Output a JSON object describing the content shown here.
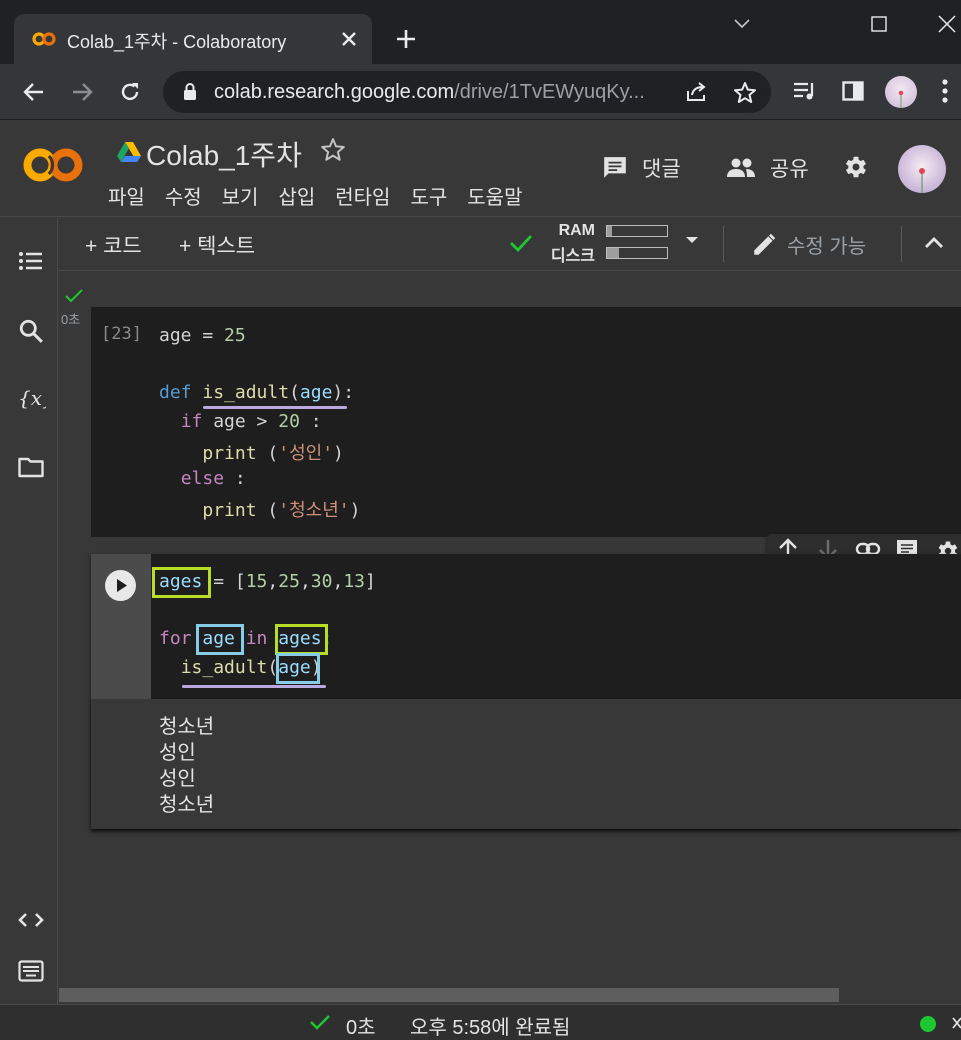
{
  "browser": {
    "tab_title": "Colab_1주차 - Colaboratory",
    "url_host": "colab.research.google.com",
    "url_path": "/drive/1TvEWyuqKy..."
  },
  "colab": {
    "notebook_title": "Colab_1주차",
    "menu": [
      "파일",
      "수정",
      "보기",
      "삽입",
      "런타임",
      "도구",
      "도움말"
    ],
    "comment_label": "댓글",
    "share_label": "공유"
  },
  "toolbar": {
    "add_code": "+ 코드",
    "add_text": "+ 텍스트",
    "ram_label": "RAM",
    "disk_label": "디스크",
    "ram_usage": 0.08,
    "disk_usage": 0.2,
    "edit_mode": "수정 가능"
  },
  "cells": {
    "cell1": {
      "execution_count": "[23]",
      "lines": [
        "age = 25",
        "",
        "def is_adult(age):",
        "  if age > 20 :",
        "    print ('성인')",
        "  else :",
        "    print ('청소년')"
      ]
    },
    "cell2": {
      "status_time": "0초",
      "lines": [
        "ages = [15,25,30,13]",
        "",
        "for age in ages:",
        "  is_adult(age)"
      ],
      "output": [
        "청소년",
        "성인",
        "성인",
        "청소년"
      ]
    }
  },
  "status_bar": {
    "elapsed": "0초",
    "completed": "오후 5:58에 완료됨"
  },
  "colors": {
    "accent_green": "#1ec72f",
    "highlight_green": "#b9dc26",
    "highlight_blue": "#87cde8",
    "underline_purple": "#b9a9e0"
  }
}
